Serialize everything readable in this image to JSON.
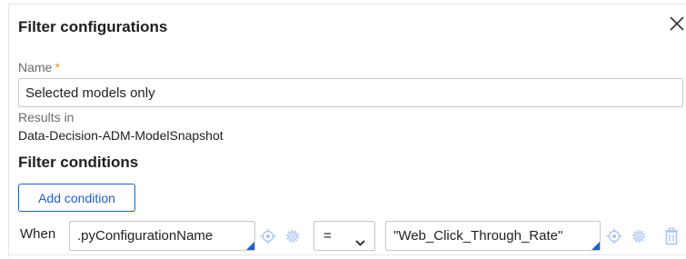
{
  "dialog": {
    "title": "Filter configurations",
    "close_icon": "close-icon"
  },
  "name_field": {
    "label": "Name",
    "required_marker": "*",
    "value": "Selected models only"
  },
  "results": {
    "label": "Results in",
    "value": "Data-Decision-ADM-ModelSnapshot"
  },
  "filter_conditions": {
    "title": "Filter conditions",
    "add_button_label": "Add condition",
    "conditions": [
      {
        "prefix": "When",
        "left_value": ".pyConfigurationName",
        "operator": "=",
        "right_value": "\"Web_Click_Through_Rate\""
      }
    ]
  },
  "colors": {
    "accent": "#1f5fd1",
    "required": "#e09a1f",
    "icon_muted": "#a9c4ef"
  }
}
